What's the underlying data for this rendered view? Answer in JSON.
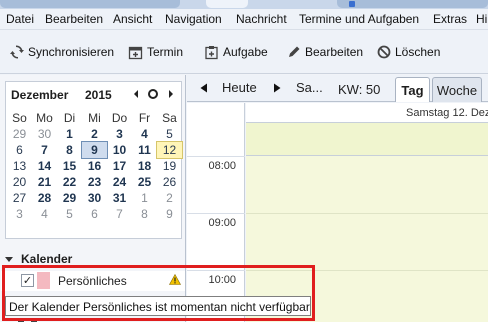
{
  "menubar": {
    "items": [
      "Datei",
      "Bearbeiten",
      "Ansicht",
      "Navigation",
      "Nachricht",
      "Termine und Aufgaben",
      "Extras",
      "Hi"
    ]
  },
  "toolbar": {
    "sync_label": "Synchronisieren",
    "event_label": "Termin",
    "task_label": "Aufgabe",
    "edit_label": "Bearbeiten",
    "delete_label": "Löschen"
  },
  "minimonth": {
    "month": "Dezember",
    "year": "2015",
    "weekdays": [
      "So",
      "Mo",
      "Di",
      "Mi",
      "Do",
      "Fr",
      "Sa"
    ],
    "weeks": [
      [
        "29",
        "30",
        "1",
        "2",
        "3",
        "4",
        "5"
      ],
      [
        "6",
        "7",
        "8",
        "9",
        "10",
        "11",
        "12"
      ],
      [
        "13",
        "14",
        "15",
        "16",
        "17",
        "18",
        "19"
      ],
      [
        "20",
        "21",
        "22",
        "23",
        "24",
        "25",
        "26"
      ],
      [
        "27",
        "28",
        "29",
        "30",
        "31",
        "1",
        "2"
      ],
      [
        "3",
        "4",
        "5",
        "6",
        "7",
        "8",
        "9"
      ]
    ]
  },
  "calendars": {
    "header": "Kalender",
    "items": [
      {
        "name": "Persönliches",
        "checked": true,
        "color": "#f4b9c0"
      }
    ]
  },
  "dayview": {
    "today_label": "Heute",
    "truncated_date": "Sa...",
    "week_label": "KW: 50",
    "tab_day": "Tag",
    "tab_week": "Woche",
    "day_header": "Samstag 12. Dez",
    "times": [
      "08:00",
      "09:00",
      "10:00"
    ]
  },
  "tooltip": {
    "text": "Der Kalender Persönliches ist momentan nicht verfügbar"
  },
  "colors": {
    "highlight": "#e01e1e",
    "day_background": "#f5f8dc",
    "today_cell": "#cfdcee",
    "selected_cell": "#fff5b8"
  }
}
